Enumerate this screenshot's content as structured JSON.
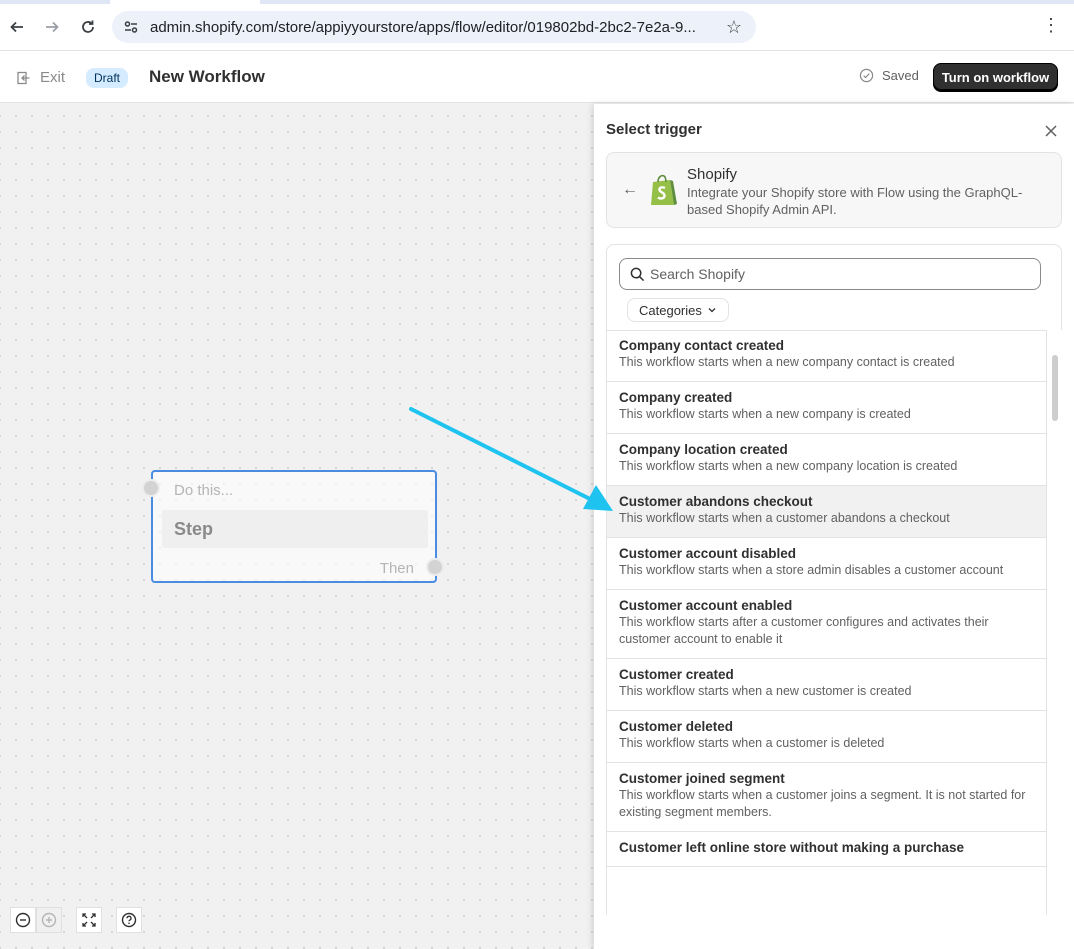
{
  "browser": {
    "url": "admin.shopify.com/store/appiyyourstore/apps/flow/editor/019802bd-2bc2-7e2a-9..."
  },
  "header": {
    "exit_label": "Exit",
    "status_badge": "Draft",
    "title": "New Workflow",
    "saved_label": "Saved",
    "turn_on_label": "Turn on workflow"
  },
  "canvas": {
    "step_prompt": "Do this...",
    "step_label": "Step",
    "then_label": "Then",
    "arrow_color": "#1ec3ef"
  },
  "panel": {
    "title": "Select trigger",
    "app": {
      "name": "Shopify",
      "description": "Integrate your Shopify store with Flow using the GraphQL-based Shopify Admin API."
    },
    "search_placeholder": "Search Shopify",
    "categories_label": "Categories",
    "triggers": [
      {
        "title": "Company contact created",
        "desc": "This workflow starts when a new company contact is created"
      },
      {
        "title": "Company created",
        "desc": "This workflow starts when a new company is created"
      },
      {
        "title": "Company location created",
        "desc": "This workflow starts when a new company location is created"
      },
      {
        "title": "Customer abandons checkout",
        "desc": "This workflow starts when a customer abandons a checkout"
      },
      {
        "title": "Customer account disabled",
        "desc": "This workflow starts when a store admin disables a customer account"
      },
      {
        "title": "Customer account enabled",
        "desc": "This workflow starts after a customer configures and activates their customer account to enable it"
      },
      {
        "title": "Customer created",
        "desc": "This workflow starts when a new customer is created"
      },
      {
        "title": "Customer deleted",
        "desc": "This workflow starts when a customer is deleted"
      },
      {
        "title": "Customer joined segment",
        "desc": "This workflow starts when a customer joins a segment. It is not started for existing segment members."
      },
      {
        "title": "Customer left online store without making a purchase",
        "desc": ""
      }
    ]
  }
}
